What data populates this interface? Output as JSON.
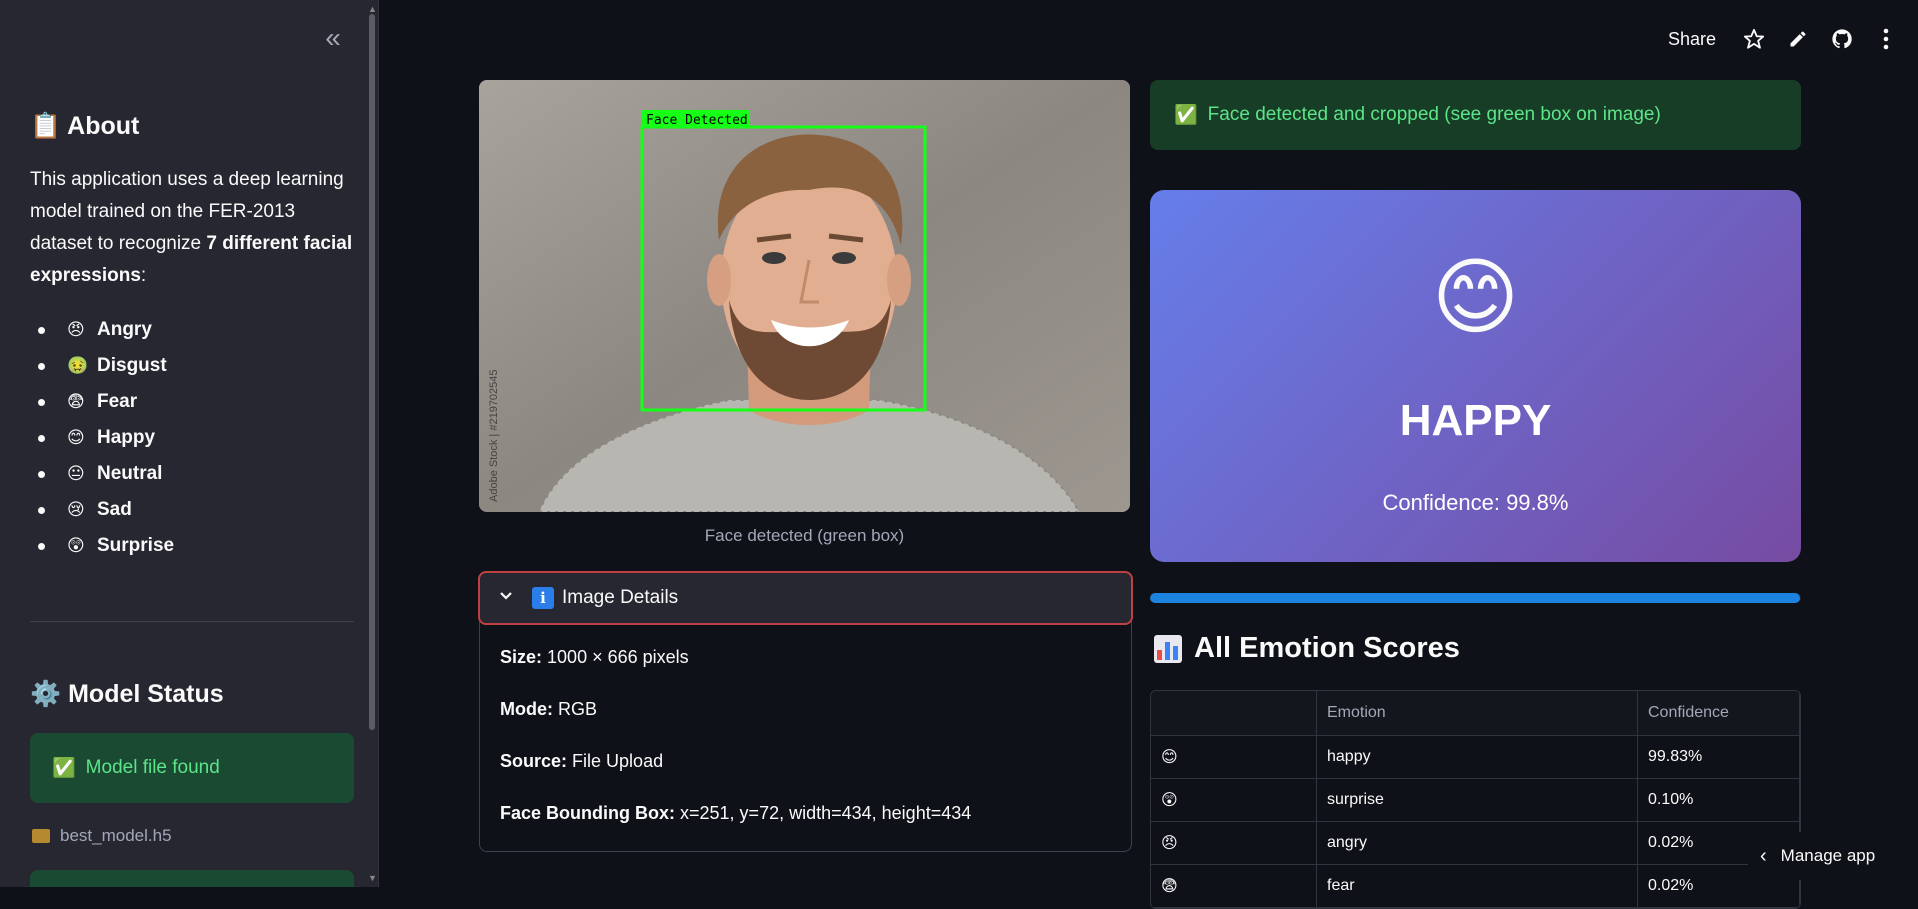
{
  "sidebar": {
    "collapse_icon": "double-chevron-left",
    "about": {
      "icon": "📋",
      "title": "About",
      "text_prefix": "This application uses a deep learning model trained on the FER-2013 dataset to recognize ",
      "text_bold": "7 different facial expressions",
      "text_suffix": ":"
    },
    "emotions": [
      {
        "emoji": "😠",
        "label": "Angry"
      },
      {
        "emoji": "🤢",
        "label": "Disgust"
      },
      {
        "emoji": "😨",
        "label": "Fear"
      },
      {
        "emoji": "😊",
        "label": "Happy"
      },
      {
        "emoji": "😐",
        "label": "Neutral"
      },
      {
        "emoji": "😢",
        "label": "Sad"
      },
      {
        "emoji": "😲",
        "label": "Surprise"
      }
    ],
    "model_status": {
      "icon": "⚙️",
      "title": "Model Status",
      "found_icon": "✅",
      "found_text": "Model file found",
      "file_name": "best_model.h5"
    }
  },
  "topbar": {
    "share_label": "Share",
    "icons": [
      "star-icon",
      "pencil-icon",
      "github-icon",
      "more-vertical-icon"
    ]
  },
  "image": {
    "box_label": "Face Detected",
    "watermark": "Adobe Stock | #219702545",
    "caption": "Face detected (green box)"
  },
  "details": {
    "title": "Image Details",
    "size_label": "Size:",
    "size_value": "1000 × 666 pixels",
    "mode_label": "Mode:",
    "mode_value": "RGB",
    "source_label": "Source:",
    "source_value": "File Upload",
    "bbox_label": "Face Bounding Box:",
    "bbox_value": "x=251, y=72, width=434, height=434"
  },
  "result": {
    "success_icon": "✅",
    "success_text": "Face detected and cropped (see green box on image)",
    "emoji": "😊",
    "label": "HAPPY",
    "confidence_text": "Confidence: 99.8%",
    "progress_fraction": 0.998,
    "gradient": [
      "#667eea",
      "#764ba2"
    ]
  },
  "scores": {
    "title": "All Emotion Scores",
    "columns": [
      "",
      "Emotion",
      "Confidence"
    ],
    "rows": [
      {
        "emoji": "😊",
        "emotion": "happy",
        "confidence": "99.83%"
      },
      {
        "emoji": "😲",
        "emotion": "surprise",
        "confidence": "0.10%"
      },
      {
        "emoji": "😠",
        "emotion": "angry",
        "confidence": "0.02%"
      },
      {
        "emoji": "😨",
        "emotion": "fear",
        "confidence": "0.02%"
      }
    ]
  },
  "manage_app": "Manage app",
  "colors": {
    "background": "#0e1117",
    "sidebar": "#262730",
    "success_text": "#5ce488",
    "accent_blue": "#1c83e1",
    "focus_red": "#bd4043"
  }
}
